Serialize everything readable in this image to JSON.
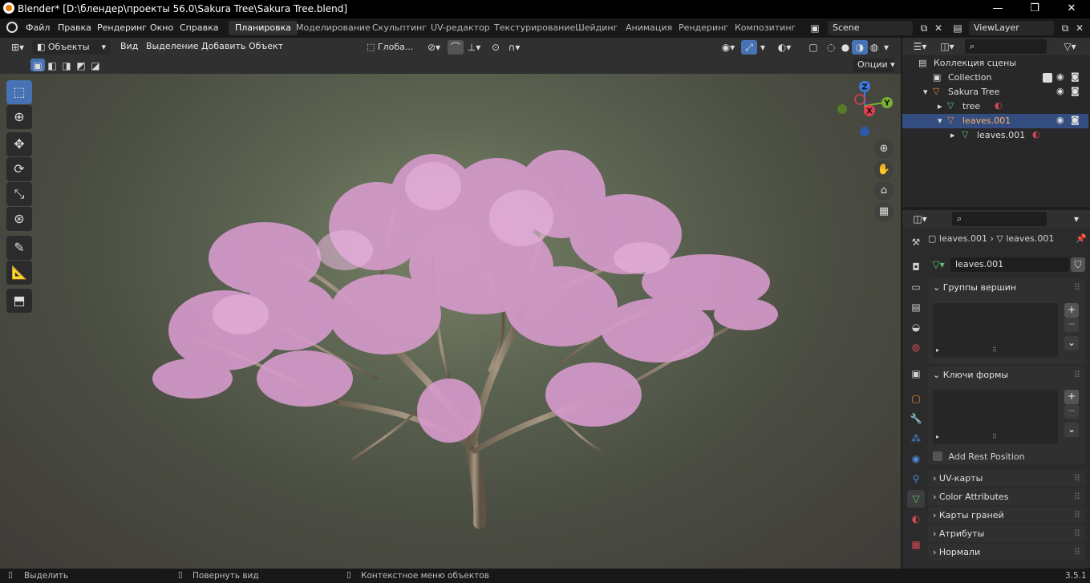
{
  "window": {
    "title": "Blender* [D:\\блендер\\проекты 56.0\\Sakura Tree\\Sakura Tree.blend]",
    "minimize": "—",
    "maximize": "❐",
    "close": "✕"
  },
  "menu": {
    "items": [
      "Файл",
      "Правка",
      "Рендеринг",
      "Окно",
      "Справка"
    ],
    "workspaces": [
      "Планировка",
      "Моделирование",
      "Скульптинг",
      "UV-редактор",
      "Текстурирование",
      "Шейдинг",
      "Анимация",
      "Рендеринг",
      "Композитинг"
    ],
    "scene": "Scene",
    "view_layer": "ViewLayer"
  },
  "viewport_header": {
    "mode": "Объекты",
    "menus": [
      "Вид",
      "Выделение",
      "Добавить",
      "Объект"
    ],
    "orientation": "Глоба...",
    "options": "Опции"
  },
  "gizmo": {
    "z": "Z",
    "y": "Y",
    "x": "X"
  },
  "outliner": {
    "scene_collection": "Коллекция сцены",
    "rows": [
      "Collection",
      "Sakura Tree",
      "tree",
      "leaves.001",
      "leaves.001"
    ]
  },
  "properties": {
    "breadcrumb_object": "leaves.001",
    "breadcrumb_data": "leaves.001",
    "data_name": "leaves.001",
    "panels": {
      "vertex_groups": "Группы вершин",
      "shape_keys": "Ключи формы",
      "add_rest_position": "Add Rest Position",
      "uv_maps": "UV-карты",
      "color_attributes": "Color Attributes",
      "face_maps": "Карты граней",
      "attributes": "Атрибуты",
      "normals": "Нормали"
    }
  },
  "status": {
    "select": "Выделить",
    "rotate": "Повернуть вид",
    "context": "Контекстное меню объектов",
    "version": "3.5.1"
  },
  "colors": {
    "accent": "#4772b3",
    "selected_row": "#334d80",
    "blossom": "#d99ccf",
    "bark": "#8a7a66"
  }
}
